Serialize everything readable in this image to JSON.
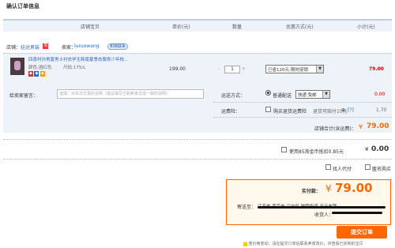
{
  "page": {
    "title": "确认订单信息"
  },
  "table_headers": {
    "item": "店铺宝贝",
    "price": "单价(元)",
    "qty": "数量",
    "discount": "优惠方式(元)",
    "subtotal": "小计(元)"
  },
  "shop": {
    "label": "店铺：",
    "name": "娃达男装",
    "badge": "淘",
    "seller_label": "卖家：",
    "seller_name": "luruowang",
    "contact_label": "和我联系"
  },
  "item": {
    "title": "四喜村孙男夏男士衬衣学生韩版夏季衣服青少年校...",
    "color": "颜色:酒红色",
    "size": "尺码:175/L",
    "price": "199.00",
    "qty": "1",
    "discount_option": "已省120元:限时促销",
    "subtotal": "79.00"
  },
  "message": {
    "label": "给卖家留言：",
    "placeholder": "选填：对本次交易的说明（建议填写已和卖家达成一致的说明）"
  },
  "shipping": {
    "label": "运送方式：",
    "option": "普通配送",
    "choice": "快递 免邮",
    "fee": "0.00"
  },
  "insurance": {
    "label": "运费险：",
    "option": "购买退货运费险",
    "note": "退货可赔付10元",
    "help": "[?]",
    "fee": "1.70"
  },
  "shop_total": {
    "label": "店铺合计(含运费)：",
    "currency": "¥",
    "value": "79.00"
  },
  "points": {
    "label": "使用85淘金币抵扣0.85元",
    "currency": "¥",
    "value": "0.00"
  },
  "options": {
    "proxy": "找人代付",
    "anonymous": "匿名购买"
  },
  "payment": {
    "label": "实付款：",
    "currency": "¥",
    "value": "79.00",
    "address_label": "寄送至：",
    "address": "江苏省 南京市 江宁区 秣陵街道 天元东路",
    "receiver_label": "收货人：",
    "submit": "提交订单"
  },
  "warning": "若价格变动，请在提交订单后联系卖家改价，并查看已买到的宝贝"
}
